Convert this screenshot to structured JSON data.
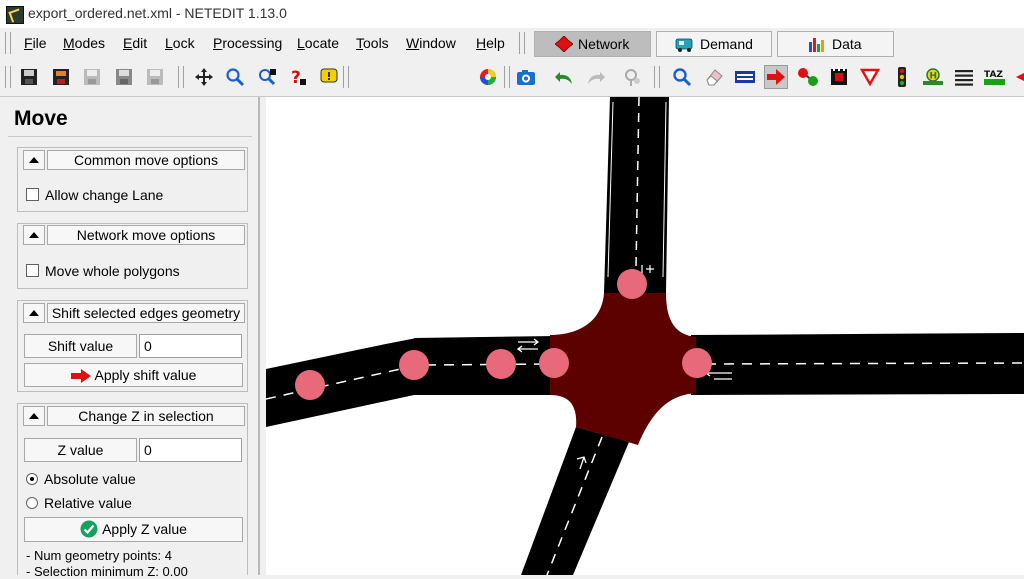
{
  "window": {
    "title": "export_ordered.net.xml - NETEDIT 1.13.0"
  },
  "menubar": {
    "items": [
      {
        "label": "File",
        "key": "F",
        "rest": "ile"
      },
      {
        "label": "Modes",
        "key": "M",
        "rest": "odes"
      },
      {
        "label": "Edit",
        "key": "E",
        "rest": "dit"
      },
      {
        "label": "Lock",
        "key": "L",
        "rest": "ock"
      },
      {
        "label": "Processing",
        "key": "P",
        "rest": "rocessing"
      },
      {
        "label": "Locate",
        "key": "L",
        "rest": "ocate"
      },
      {
        "label": "Tools",
        "key": "T",
        "rest": "ools"
      },
      {
        "label": "Window",
        "key": "W",
        "rest": "indow"
      },
      {
        "label": "Help",
        "key": "H",
        "rest": "elp"
      }
    ],
    "supermodes": [
      {
        "label": "Network",
        "icon": "network-icon",
        "active": true
      },
      {
        "label": "Demand",
        "icon": "demand-icon",
        "active": false
      },
      {
        "label": "Data",
        "icon": "data-icon",
        "active": false
      }
    ]
  },
  "toolbar": {
    "scheme_value": "standard",
    "icons": [
      "save-network-icon",
      "save-additionals-icon",
      "save-demand-icon",
      "save-data-icon",
      "save-meandata-icon",
      "move-view-icon",
      "zoom-icon",
      "locate-icon",
      "help-icon",
      "tooltip-icon",
      "color-wheel-icon",
      "screenshot-icon",
      "undo-icon",
      "redo-icon",
      "reload-icon",
      "inspect-icon",
      "delete-icon",
      "select-icon",
      "move-icon",
      "connection-icon",
      "crossing-icon",
      "prohibition-icon",
      "traffic-light-icon",
      "additional-icon",
      "wire-icon",
      "taz-icon"
    ]
  },
  "panel": {
    "title": "Move",
    "common": {
      "header": "Common move options",
      "checkbox": "Allow change Lane"
    },
    "network": {
      "header": "Network move options",
      "checkbox": "Move whole polygons"
    },
    "shift": {
      "header": "Shift selected edges geometry",
      "label": "Shift value",
      "value": "0",
      "apply": "Apply shift value"
    },
    "z": {
      "header": "Change Z in selection",
      "label": "Z value",
      "value": "0",
      "absolute": "Absolute value",
      "relative": "Relative value",
      "apply": "Apply Z value"
    },
    "info": [
      "- Num geometry points: 4",
      "- Selection minimum Z: 0.00"
    ]
  },
  "colors": {
    "road": "#000000",
    "junction": "#5c0000",
    "geometry_point": "#e8697a",
    "lane_marking": "#ffffff",
    "active_mode": "#bdbdbd"
  }
}
